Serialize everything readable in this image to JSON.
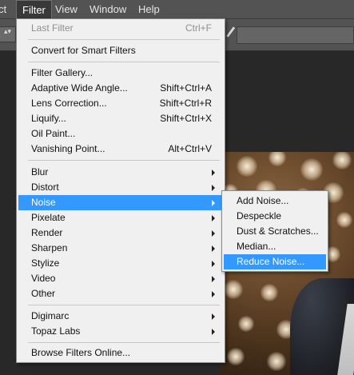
{
  "menubar": {
    "items": [
      {
        "label": "ct"
      },
      {
        "label": "Filter",
        "active": true
      },
      {
        "label": "View"
      },
      {
        "label": "Window"
      },
      {
        "label": "Help"
      }
    ]
  },
  "options_bar": {
    "stepper": "▴▾",
    "tool_icon": "pen-icon"
  },
  "filter_menu": {
    "last_filter": {
      "label": "Last Filter",
      "shortcut": "Ctrl+F",
      "enabled": false
    },
    "convert_smart": {
      "label": "Convert for Smart Filters"
    },
    "group1": [
      {
        "label": "Filter Gallery...",
        "shortcut": ""
      },
      {
        "label": "Adaptive Wide Angle...",
        "shortcut": "Shift+Ctrl+A"
      },
      {
        "label": "Lens Correction...",
        "shortcut": "Shift+Ctrl+R"
      },
      {
        "label": "Liquify...",
        "shortcut": "Shift+Ctrl+X"
      },
      {
        "label": "Oil Paint...",
        "shortcut": ""
      },
      {
        "label": "Vanishing Point...",
        "shortcut": "Alt+Ctrl+V"
      }
    ],
    "group2": [
      {
        "label": "Blur"
      },
      {
        "label": "Distort"
      },
      {
        "label": "Noise",
        "highlighted": true
      },
      {
        "label": "Pixelate"
      },
      {
        "label": "Render"
      },
      {
        "label": "Sharpen"
      },
      {
        "label": "Stylize"
      },
      {
        "label": "Video"
      },
      {
        "label": "Other"
      }
    ],
    "group3": [
      {
        "label": "Digimarc"
      },
      {
        "label": "Topaz Labs"
      }
    ],
    "browse": {
      "label": "Browse Filters Online..."
    }
  },
  "noise_submenu": {
    "items": [
      {
        "label": "Add Noise..."
      },
      {
        "label": "Despeckle"
      },
      {
        "label": "Dust & Scratches..."
      },
      {
        "label": "Median..."
      },
      {
        "label": "Reduce Noise...",
        "highlighted": true
      }
    ]
  },
  "colors": {
    "highlight": "#3399ff",
    "menu_bg": "#f0f0f0",
    "chrome": "#535353"
  }
}
